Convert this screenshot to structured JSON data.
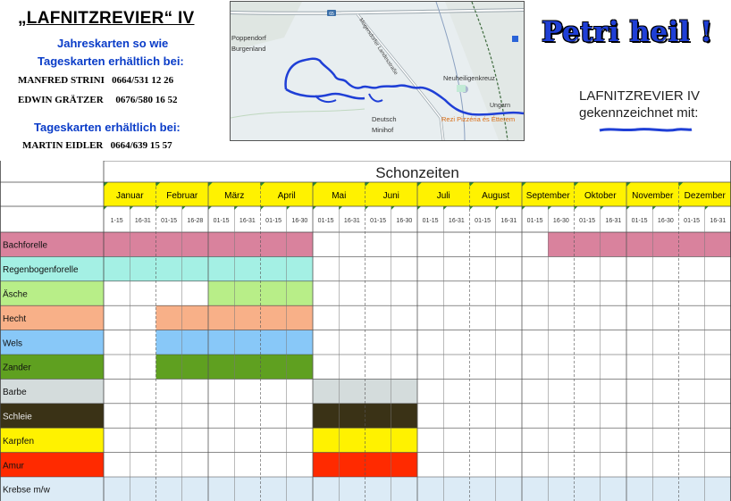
{
  "header": {
    "title": "„LAFNITZREVIER“ IV",
    "line1": "Jahreskarten so wie",
    "line2": "Tageskarten erhältlich bei:",
    "contact1": "MANFRED STRINI   0664/531 12 26",
    "contact2": "EDWIN GRÄTZER     0676/580 16 52",
    "line3": "Tageskarten erhältlich bei:",
    "contact3": "MARTIN EIDLER   0664/639 15 57"
  },
  "map": {
    "labels": {
      "route": "65",
      "poppendorf": "Poppendorf",
      "burgenland": "Burgenland",
      "road": "Mogersdorfer Landesstraße",
      "neuheiligenkreuz": "Neuheiligenkreuz",
      "ungarn": "Ungarn",
      "deutsch": "Deutsch",
      "minihof": "Minihof",
      "pizzeria": "Rezi Pizzéria és Étterem"
    }
  },
  "greeting": "Petri heil !",
  "marker": {
    "line1": "LAFNITZREVIER IV",
    "line2": "gekennzeichnet mit:",
    "color": "#1f3fd6"
  },
  "chart_data": {
    "type": "table",
    "title": "Schonzeiten",
    "months": [
      "Januar",
      "Februar",
      "März",
      "April",
      "Mai",
      "Juni",
      "Juli",
      "August",
      "September",
      "Oktober",
      "November",
      "Dezember"
    ],
    "half_labels": [
      "1-15",
      "16-31",
      "01-15",
      "16-28",
      "01-15",
      "16-31",
      "01-15",
      "16-30",
      "01-15",
      "16-31",
      "01-15",
      "16-30",
      "01-15",
      "16-31",
      "01-15",
      "16-31",
      "01-15",
      "16-30",
      "01-15",
      "16-31",
      "01-15",
      "16-30",
      "01-15",
      "16-31"
    ],
    "species": [
      {
        "name": "Bachforelle",
        "color": "#d9829d",
        "closed": [
          1,
          1,
          1,
          1,
          1,
          1,
          1,
          1,
          0,
          0,
          0,
          0,
          0,
          0,
          0,
          0,
          0,
          1,
          1,
          1,
          1,
          1,
          1,
          1
        ]
      },
      {
        "name": "Regenbogenforelle",
        "color": "#a4f0e4",
        "closed": [
          1,
          1,
          1,
          1,
          1,
          1,
          1,
          1,
          0,
          0,
          0,
          0,
          0,
          0,
          0,
          0,
          0,
          0,
          0,
          0,
          0,
          0,
          0,
          0
        ]
      },
      {
        "name": "Äsche",
        "color": "#b8ee88",
        "closed": [
          0,
          0,
          0,
          0,
          1,
          1,
          1,
          1,
          0,
          0,
          0,
          0,
          0,
          0,
          0,
          0,
          0,
          0,
          0,
          0,
          0,
          0,
          0,
          0
        ]
      },
      {
        "name": "Hecht",
        "color": "#f8b088",
        "closed": [
          0,
          0,
          1,
          1,
          1,
          1,
          1,
          1,
          0,
          0,
          0,
          0,
          0,
          0,
          0,
          0,
          0,
          0,
          0,
          0,
          0,
          0,
          0,
          0
        ]
      },
      {
        "name": "Wels",
        "color": "#88c8f8",
        "closed": [
          0,
          0,
          1,
          1,
          1,
          1,
          1,
          1,
          0,
          0,
          0,
          0,
          0,
          0,
          0,
          0,
          0,
          0,
          0,
          0,
          0,
          0,
          0,
          0
        ]
      },
      {
        "name": "Zander",
        "color": "#5fa020",
        "closed": [
          0,
          0,
          1,
          1,
          1,
          1,
          1,
          1,
          0,
          0,
          0,
          0,
          0,
          0,
          0,
          0,
          0,
          0,
          0,
          0,
          0,
          0,
          0,
          0
        ]
      },
      {
        "name": "Barbe",
        "color": "#d4dcdc",
        "closed": [
          0,
          0,
          0,
          0,
          0,
          0,
          0,
          0,
          1,
          1,
          1,
          1,
          0,
          0,
          0,
          0,
          0,
          0,
          0,
          0,
          0,
          0,
          0,
          0
        ]
      },
      {
        "name": "Schleie",
        "color": "#3a3216",
        "closed": [
          0,
          0,
          0,
          0,
          0,
          0,
          0,
          0,
          1,
          1,
          1,
          1,
          0,
          0,
          0,
          0,
          0,
          0,
          0,
          0,
          0,
          0,
          0,
          0
        ]
      },
      {
        "name": "Karpfen",
        "color": "#fff200",
        "closed": [
          0,
          0,
          0,
          0,
          0,
          0,
          0,
          0,
          1,
          1,
          1,
          1,
          0,
          0,
          0,
          0,
          0,
          0,
          0,
          0,
          0,
          0,
          0,
          0
        ]
      },
      {
        "name": "Amur",
        "color": "#ff2a00",
        "closed": [
          0,
          0,
          0,
          0,
          0,
          0,
          0,
          0,
          1,
          1,
          1,
          1,
          0,
          0,
          0,
          0,
          0,
          0,
          0,
          0,
          0,
          0,
          0,
          0
        ]
      },
      {
        "name": "Krebse  m/w",
        "color": "#dcebf6",
        "closed": [
          1,
          1,
          1,
          1,
          1,
          1,
          1,
          1,
          1,
          1,
          1,
          1,
          1,
          1,
          1,
          1,
          1,
          1,
          1,
          1,
          1,
          1,
          1,
          1
        ]
      }
    ],
    "month_color": "#fff200",
    "grid": true
  }
}
